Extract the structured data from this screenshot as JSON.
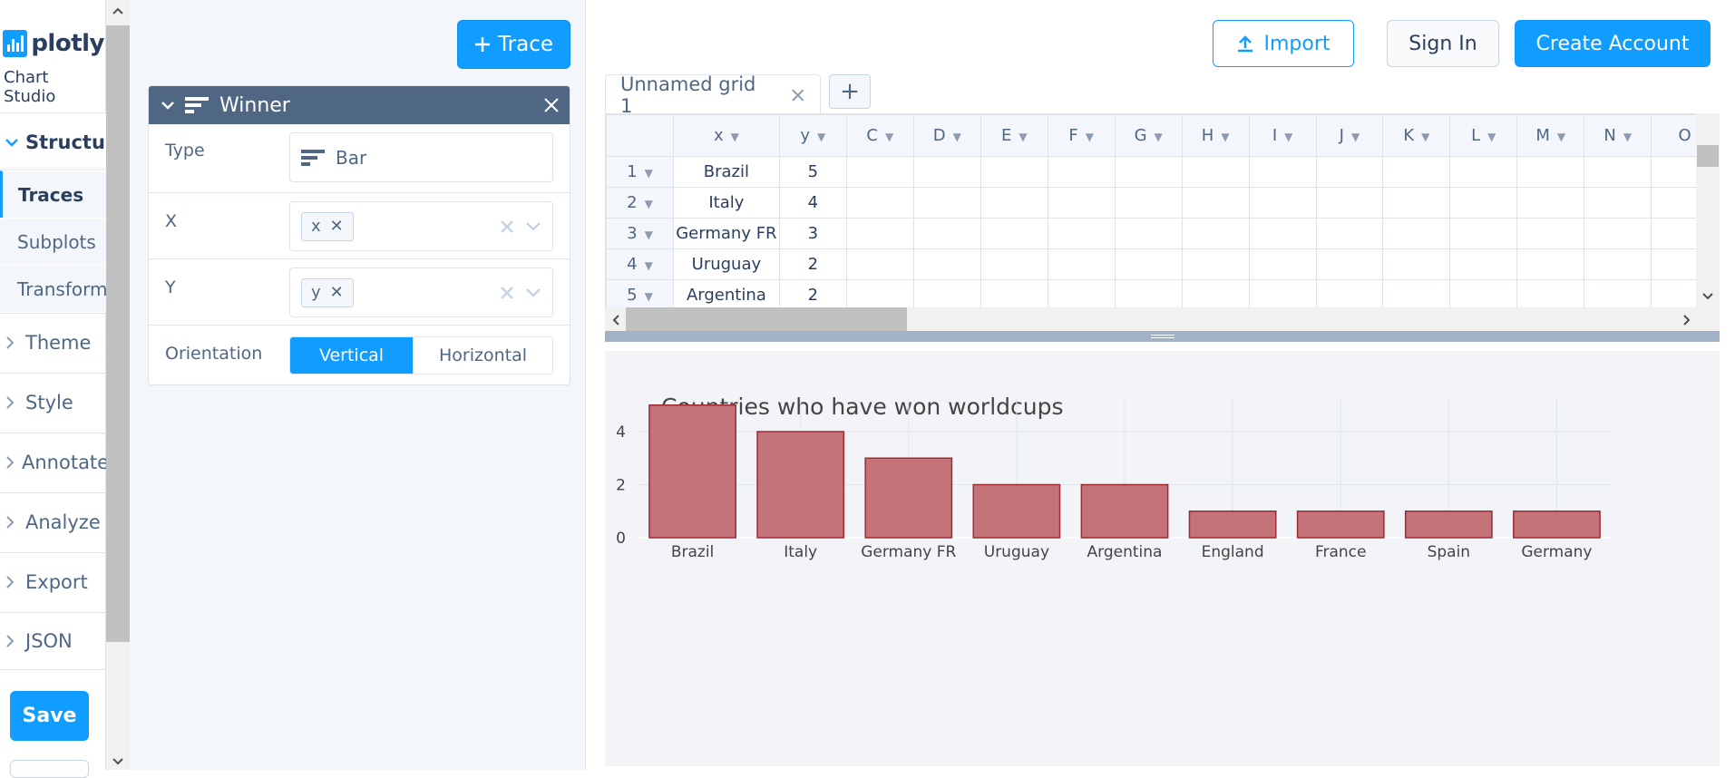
{
  "nav": {
    "logo_text": "plotly",
    "subtitle": "Chart Studio",
    "structure": "Structure",
    "traces": "Traces",
    "subplots": "Subplots",
    "transforms": "Transforms",
    "sections": [
      "Theme",
      "Style",
      "Annotate",
      "Analyze",
      "Export",
      "JSON"
    ],
    "save": "Save"
  },
  "panel": {
    "add_trace": "Trace",
    "trace_name": "Winner",
    "type_label": "Type",
    "type_value": "Bar",
    "x_label": "X",
    "x_value": "x",
    "y_label": "Y",
    "y_value": "y",
    "orientation_label": "Orientation",
    "orientation_options": [
      "Vertical",
      "Horizontal"
    ],
    "orientation_selected": "Vertical"
  },
  "topbar": {
    "import": "Import",
    "sign_in": "Sign In",
    "create_account": "Create Account"
  },
  "grid": {
    "tab_name": "Unnamed grid 1",
    "add_tab": "+",
    "columns": [
      "x",
      "y",
      "C",
      "D",
      "E",
      "F",
      "G",
      "H",
      "I",
      "J",
      "K",
      "L",
      "M",
      "N",
      "O"
    ],
    "rows": [
      {
        "n": "1",
        "x": "Brazil",
        "y": "5"
      },
      {
        "n": "2",
        "x": "Italy",
        "y": "4"
      },
      {
        "n": "3",
        "x": "Germany FR",
        "y": "3"
      },
      {
        "n": "4",
        "x": "Uruguay",
        "y": "2"
      },
      {
        "n": "5",
        "x": "Argentina",
        "y": "2"
      }
    ]
  },
  "colors": {
    "accent": "#119dff",
    "bar_fill": "#c47478",
    "bar_stroke": "#9e2a35",
    "header": "#506784"
  },
  "chart_data": {
    "type": "bar",
    "title": "Countries who have won worldcups",
    "categories": [
      "Brazil",
      "Italy",
      "Germany FR",
      "Uruguay",
      "Argentina",
      "England",
      "France",
      "Spain",
      "Germany"
    ],
    "values": [
      5,
      4,
      3,
      2,
      2,
      1,
      1,
      1,
      1
    ],
    "yticks": [
      "0",
      "2",
      "4"
    ],
    "ylim": [
      0,
      5.26
    ],
    "grid": true,
    "xlabel": "",
    "ylabel": ""
  }
}
